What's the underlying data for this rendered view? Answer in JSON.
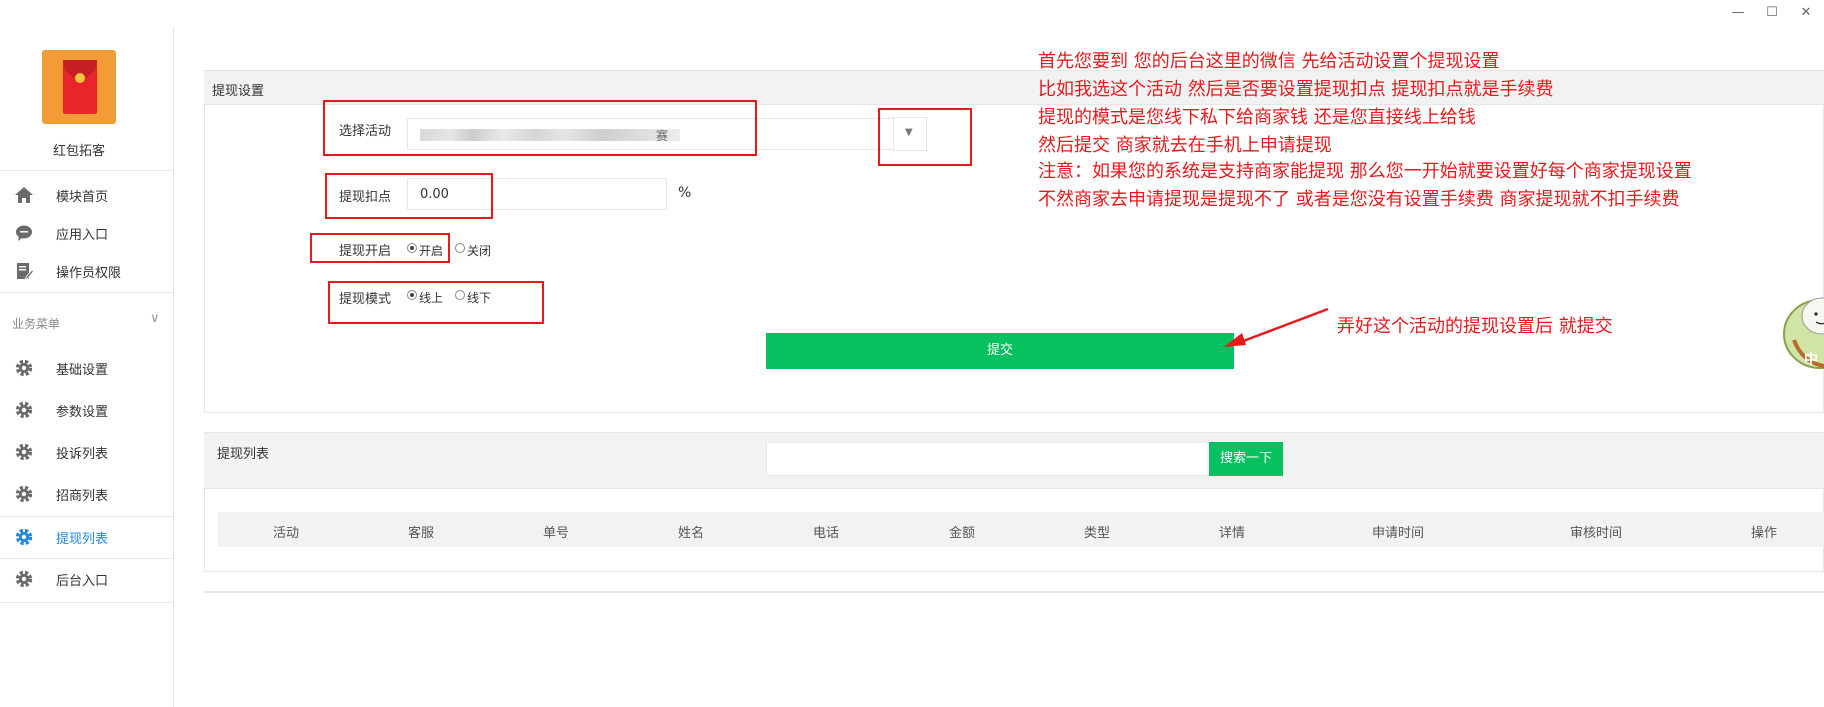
{
  "window": {
    "minimize_glyph": "—",
    "maximize_glyph": "☐",
    "close_glyph": "✕"
  },
  "sidebar": {
    "app_name": "红包拓客",
    "top_items": [
      {
        "label": "模块首页",
        "icon": "home-icon"
      },
      {
        "label": "应用入口",
        "icon": "chat-icon"
      },
      {
        "label": "操作员权限",
        "icon": "document-edit-icon"
      }
    ],
    "section_title": "业务菜单",
    "section_chevron": "∨",
    "business_items": [
      {
        "label": "基础设置",
        "icon": "gear-icon"
      },
      {
        "label": "参数设置",
        "icon": "gear-icon"
      },
      {
        "label": "投诉列表",
        "icon": "gear-icon"
      },
      {
        "label": "招商列表",
        "icon": "gear-icon"
      },
      {
        "label": "提现列表",
        "icon": "gear-icon",
        "active": true
      },
      {
        "label": "后台入口",
        "icon": "gear-icon"
      }
    ]
  },
  "withdraw_settings": {
    "title": "提现设置",
    "select_activity_label": "选择活动",
    "select_activity_value_suffix": "赛",
    "fee_label": "提现扣点",
    "fee_value": "0.00",
    "fee_unit": "%",
    "enable_label": "提现开启",
    "enable_options": [
      "开启",
      "关闭"
    ],
    "enable_selected": "开启",
    "mode_label": "提现模式",
    "mode_options": [
      "线上",
      "线下"
    ],
    "mode_selected": "线上",
    "submit_label": "提交"
  },
  "withdraw_list": {
    "title": "提现列表",
    "search_placeholder": "",
    "search_button": "搜索一下",
    "columns": [
      "活动",
      "客服",
      "单号",
      "姓名",
      "电话",
      "金额",
      "类型",
      "详情",
      "申请时间",
      "审核时间",
      "操作"
    ]
  },
  "annotations": {
    "lines": [
      "首先您要到 您的后台这里的微信 先给活动设置个提现设置",
      "比如我选这个活动  然后是否要设置提现扣点 提现扣点就是手续费",
      "提现的模式是您线下私下给商家钱  还是您直接线上给钱",
      "然后提交  商家就去在手机上申请提现",
      "注意：如果您的系统是支持商家能提现 那么您一开始就要设置好每个商家提现设置",
      "不然商家去申请提现是提现不了 或者是您没有设置手续费 商家提现就不扣手续费"
    ],
    "side_note": "弄好这个活动的提现设置后 就提交",
    "color": "#e8191c"
  },
  "sticker": {
    "text": "中"
  },
  "colors": {
    "accent_green": "#07c160",
    "active_blue": "#1e88e5",
    "annotation_red": "#e8191c"
  }
}
